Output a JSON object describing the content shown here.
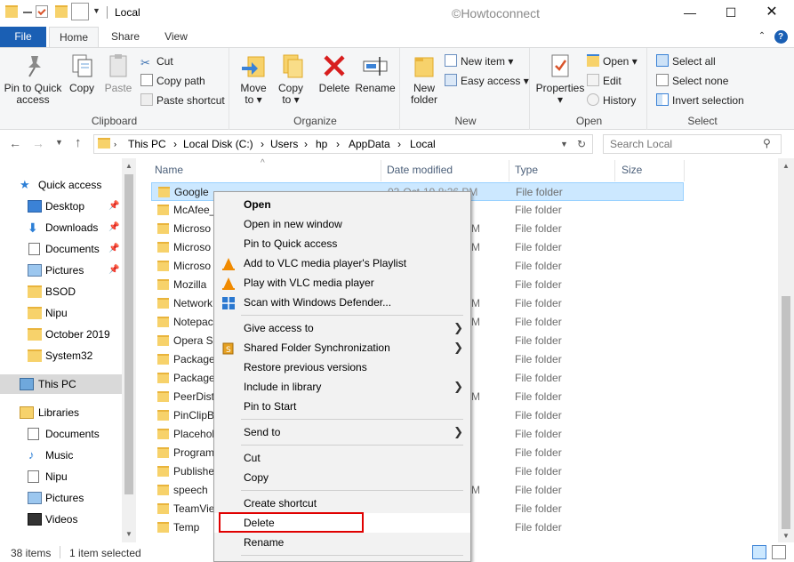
{
  "window": {
    "title": "Local",
    "watermark": "©Howtoconnect"
  },
  "tabs": {
    "file": "File",
    "home": "Home",
    "share": "Share",
    "view": "View"
  },
  "ribbon": {
    "clipboard": {
      "label": "Clipboard",
      "pin_line1": "Pin to Quick",
      "pin_line2": "access",
      "copy": "Copy",
      "paste": "Paste",
      "cut": "Cut",
      "copy_path": "Copy path",
      "paste_shortcut": "Paste shortcut"
    },
    "organize": {
      "label": "Organize",
      "move_to": "Move",
      "move_to2": "to ▾",
      "copy_to": "Copy",
      "copy_to2": "to ▾",
      "delete": "Delete",
      "rename": "Rename"
    },
    "new": {
      "label": "New",
      "new_folder1": "New",
      "new_folder2": "folder",
      "new_item": "New item ▾",
      "easy_access": "Easy access ▾"
    },
    "open": {
      "label": "Open",
      "properties": "Properties",
      "properties2": "▾",
      "open": "Open ▾",
      "edit": "Edit",
      "history": "History"
    },
    "select": {
      "label": "Select",
      "select_all": "Select all",
      "select_none": "Select none",
      "invert": "Invert selection"
    }
  },
  "address": {
    "path": [
      "This PC",
      "Local Disk (C:)",
      "Users",
      "hp",
      "AppData",
      "Local"
    ],
    "search_placeholder": "Search Local"
  },
  "nav": {
    "quick_access": "Quick access",
    "items": [
      "Desktop",
      "Downloads",
      "Documents",
      "Pictures",
      "BSOD",
      "Nipu",
      "October 2019",
      "System32"
    ],
    "this_pc": "This PC",
    "libraries": "Libraries",
    "lib_items": [
      "Documents",
      "Music",
      "Nipu",
      "Pictures",
      "Videos"
    ]
  },
  "columns": {
    "name": "Name",
    "date": "Date modified",
    "type": "Type",
    "size": "Size"
  },
  "files": [
    {
      "name": "Google",
      "date": "03-Oct-19 8:26 PM",
      "type": "File folder"
    },
    {
      "name": "McAfee_",
      "type": "File folder"
    },
    {
      "name": "Microso",
      "date": "M",
      "type": "File folder"
    },
    {
      "name": "Microso",
      "date": "M",
      "type": "File folder"
    },
    {
      "name": "Microso",
      "type": "File folder"
    },
    {
      "name": "Mozilla",
      "type": "File folder"
    },
    {
      "name": "Network",
      "date": "M",
      "type": "File folder"
    },
    {
      "name": "Notepac",
      "date": "M",
      "type": "File folder"
    },
    {
      "name": "Opera Sc",
      "type": "File folder"
    },
    {
      "name": "Package",
      "type": "File folder"
    },
    {
      "name": "Package",
      "type": "File folder"
    },
    {
      "name": "PeerDist",
      "date": "M",
      "type": "File folder"
    },
    {
      "name": "PinClipB",
      "type": "File folder"
    },
    {
      "name": "Placehol",
      "type": "File folder"
    },
    {
      "name": "Program",
      "type": "File folder"
    },
    {
      "name": "Publishe",
      "type": "File folder"
    },
    {
      "name": "speech",
      "date": "M",
      "type": "File folder"
    },
    {
      "name": "TeamVie",
      "type": "File folder"
    },
    {
      "name": "Temp",
      "type": "File folder"
    }
  ],
  "status": {
    "count": "38 items",
    "selected": "1 item selected"
  },
  "context_menu": {
    "open": "Open",
    "open_new_window": "Open in new window",
    "pin_quick": "Pin to Quick access",
    "vlc_add": "Add to VLC media player's Playlist",
    "vlc_play": "Play with VLC media player",
    "defender": "Scan with Windows Defender...",
    "give_access": "Give access to",
    "shared_sync": "Shared Folder Synchronization",
    "restore": "Restore previous versions",
    "include_library": "Include in library",
    "pin_start": "Pin to Start",
    "send_to": "Send to",
    "cut": "Cut",
    "copy": "Copy",
    "create_shortcut": "Create shortcut",
    "delete": "Delete",
    "rename": "Rename"
  },
  "colors": {
    "accent": "#1a5fb4",
    "selection": "#cce8ff",
    "highlight": "#e00000",
    "folder": "#f7d26b"
  }
}
